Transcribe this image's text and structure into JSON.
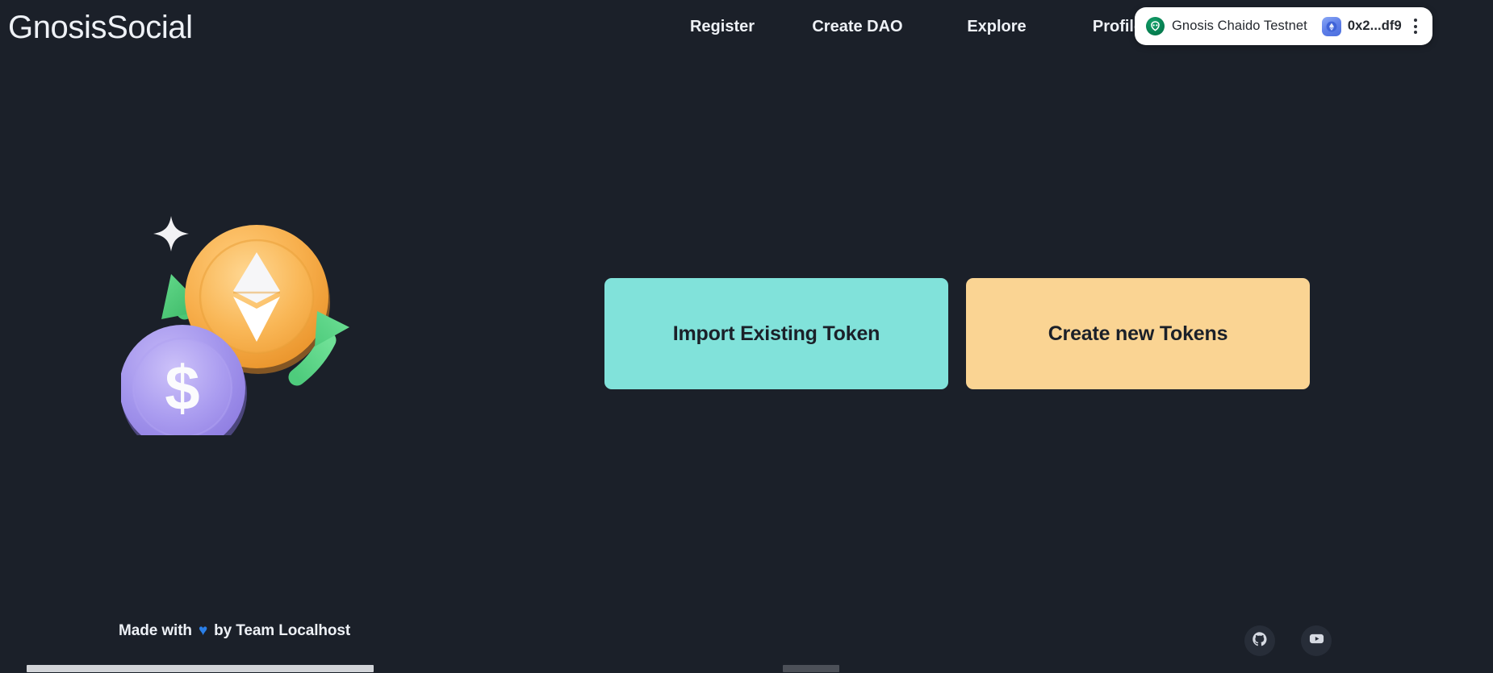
{
  "brand": {
    "name": "GnosisSocial"
  },
  "nav": {
    "items": [
      {
        "label": "Register",
        "name": "nav-register"
      },
      {
        "label": "Create DAO",
        "name": "nav-create-dao"
      },
      {
        "label": "Explore",
        "name": "nav-explore"
      },
      {
        "label": "Profile",
        "name": "nav-profile"
      }
    ]
  },
  "wallet": {
    "chain_name": "Gnosis Chaido Testnet",
    "chain_icon": "gnosis-owl-icon",
    "account_address": "0x2...df9",
    "account_icon": "ethereum-token-icon",
    "menu_icon": "kebab-menu-icon",
    "background": "#ffffff"
  },
  "illustration": {
    "name": "token-swap-3d-illustration",
    "elements": [
      "orange-ethereum-coin",
      "purple-dollar-coin",
      "green-arrow-down-left",
      "green-arrow-up-right",
      "white-sparkle"
    ],
    "colors": {
      "orange_coin": "#f5a93f",
      "purple_coin": "#9d8ae8",
      "green_arrow": "#4cc578",
      "sparkle": "#f2f2f4"
    }
  },
  "main": {
    "buttons": [
      {
        "label": "Import Existing Token",
        "name": "import-existing-token-button",
        "color": "#81e2da"
      },
      {
        "label": "Create new Tokens",
        "name": "create-new-tokens-button",
        "color": "#fad493"
      }
    ]
  },
  "footer": {
    "made_with_prefix": "Made with",
    "heart_glyph": "♥",
    "made_with_suffix": "by Team Localhost",
    "socials": [
      {
        "name": "github-icon",
        "label": "GitHub"
      },
      {
        "name": "youtube-icon",
        "label": "YouTube"
      }
    ]
  },
  "colors": {
    "page_background": "#1b2029",
    "text_primary": "#eef1f6",
    "accent_teal": "#81e2da",
    "accent_amber": "#fad493",
    "accent_blue": "#2a7fe8"
  }
}
